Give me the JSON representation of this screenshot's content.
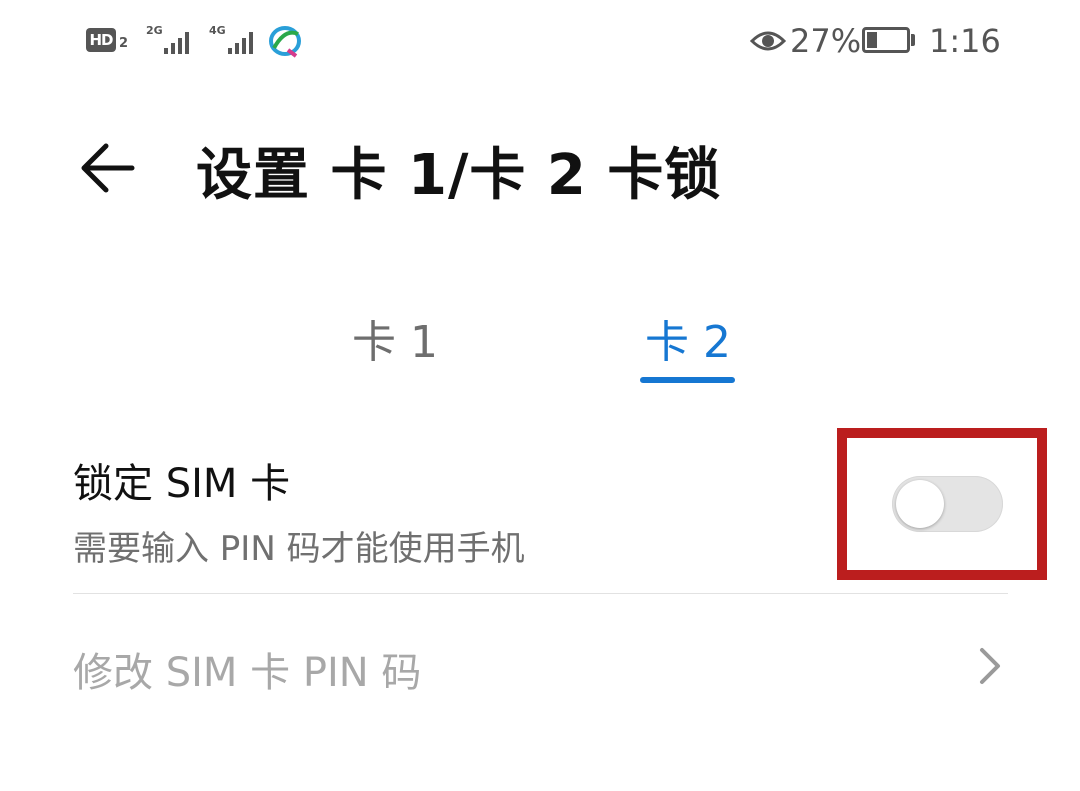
{
  "status_bar": {
    "hd_label": "HD",
    "hd_slot": "2",
    "network_1": "2G",
    "network_2": "4G",
    "carrier_icon": "china-mobile-icon",
    "eye_icon": "eye-comfort-icon",
    "battery_percent": "27%",
    "battery_level": 0.27,
    "time": "1:16"
  },
  "header": {
    "back_icon": "back-arrow-icon",
    "title": "设置 卡 1/卡 2 卡锁"
  },
  "tabs": [
    {
      "label": "卡 1",
      "selected": false
    },
    {
      "label": "卡 2",
      "selected": true
    }
  ],
  "settings": {
    "lock_sim": {
      "title": "锁定 SIM 卡",
      "subtitle": "需要输入 PIN 码才能使用手机",
      "enabled": false
    },
    "change_pin": {
      "title": "修改 SIM 卡 PIN 码",
      "chevron_icon": "chevron-right-icon"
    }
  },
  "colors": {
    "accent": "#1677d2",
    "highlight_box": "#bb1e1e"
  }
}
